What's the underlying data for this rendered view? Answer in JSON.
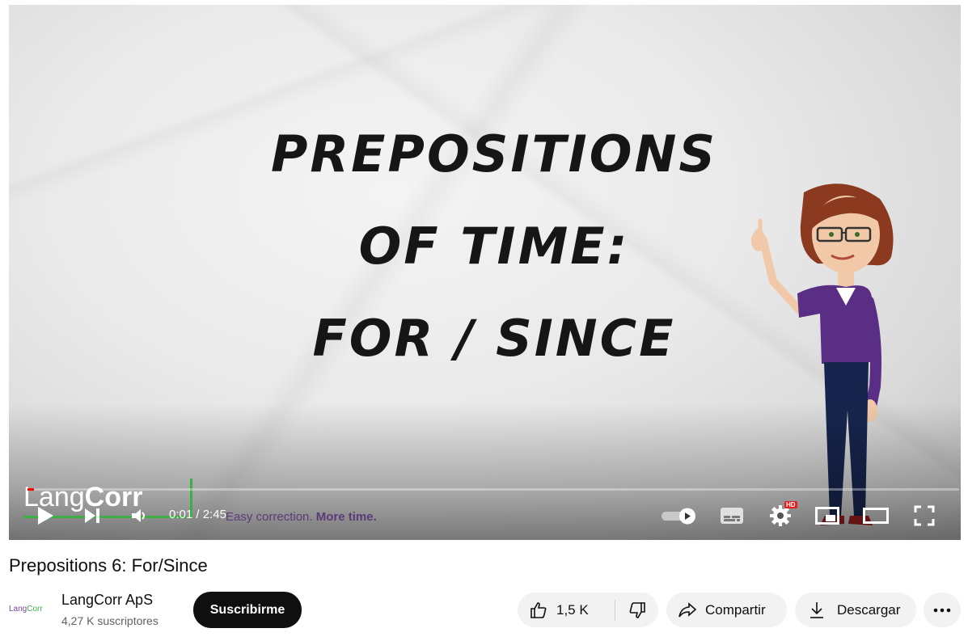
{
  "video": {
    "title_lines": [
      "PREPOSITIONS",
      "OF TIME:",
      "FOR / SINCE"
    ],
    "watermark": {
      "lang": "Lang",
      "corr": "Corr"
    },
    "tagline": {
      "left": "Easy correction.",
      "right": "More time."
    },
    "progress_fraction": 0.006,
    "time": {
      "current": "0:01",
      "separator": " / ",
      "duration": "2:45"
    },
    "hd_badge": "HD",
    "icons": [
      "play-icon",
      "next-icon",
      "volume-icon",
      "autoplay-toggle-icon",
      "subtitles-icon",
      "settings-icon",
      "miniplayer-icon",
      "theater-mode-icon",
      "fullscreen-icon"
    ]
  },
  "meta": {
    "title": "Prepositions 6: For/Since",
    "channel": {
      "avatar_text": {
        "a": "Lang",
        "b": "Corr"
      },
      "name": "LangCorr ApS",
      "subscribers": "4,27 K suscriptores",
      "subscribe_label": "Suscribirme"
    },
    "actions": {
      "like_count": "1,5 K",
      "share_label": "Compartir",
      "download_label": "Descargar"
    }
  },
  "colors": {
    "accent": "#ff0000",
    "brand_purple": "#5b3b7a",
    "brand_green": "#3cb043"
  }
}
